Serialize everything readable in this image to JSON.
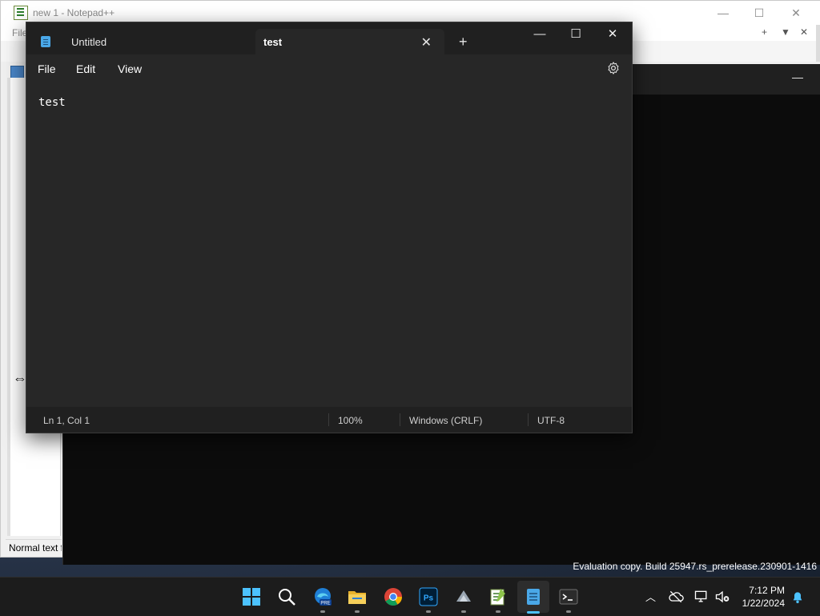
{
  "notepadpp": {
    "title": "new 1 - Notepad++",
    "menu_first": "File",
    "status_text": "Normal text f",
    "right_menu": [
      "+",
      "▼",
      "✕"
    ]
  },
  "notepad": {
    "tabs": [
      {
        "label": "Untitled",
        "active": false
      },
      {
        "label": "test",
        "active": true
      }
    ],
    "menu": [
      "File",
      "Edit",
      "View"
    ],
    "content": "test",
    "status": {
      "position": "Ln 1, Col 1",
      "zoom": "100%",
      "line_ending": "Windows (CRLF)",
      "encoding": "UTF-8"
    }
  },
  "watermark": "Evaluation copy. Build 25947.rs_prerelease.230901-1416",
  "taskbar": {
    "apps": [
      "start",
      "search",
      "edge-beta",
      "file-explorer",
      "chrome",
      "photoshop",
      "app-x",
      "notepadpp",
      "notepad",
      "terminal"
    ],
    "clock_time": "7:12 PM",
    "clock_date": "1/22/2024"
  },
  "colors": {
    "notepad_bg": "#272727",
    "accent": "#4cc2ff",
    "taskbar": "#1c1c1c"
  }
}
